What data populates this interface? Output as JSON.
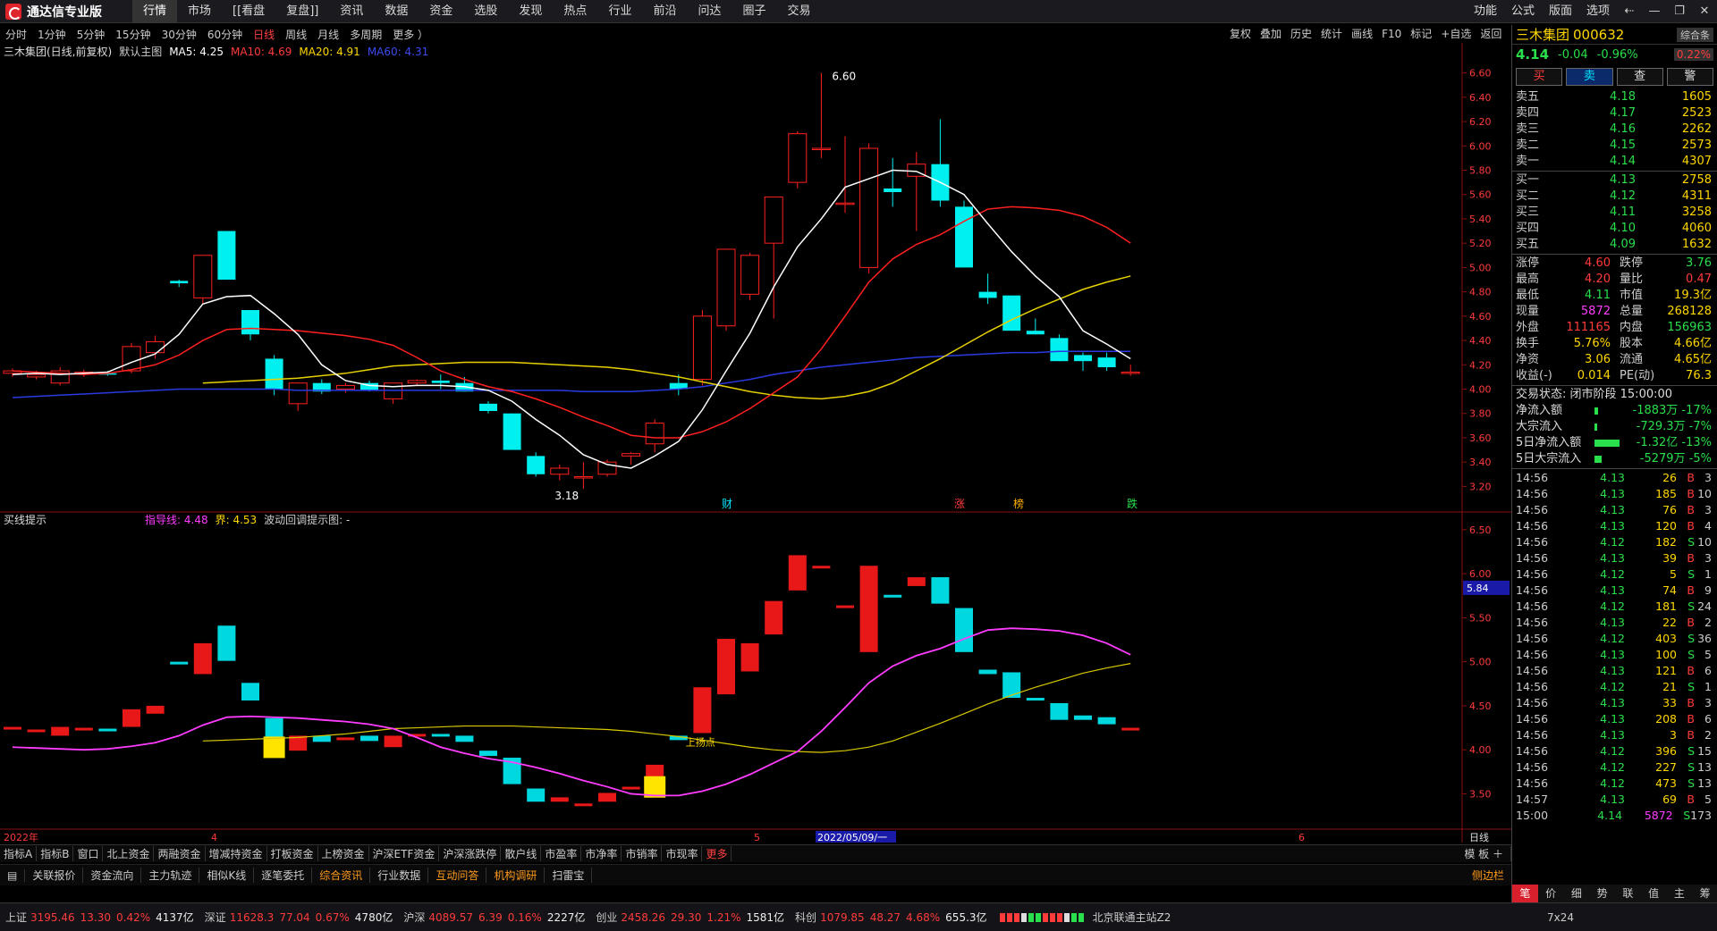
{
  "app": {
    "name": "通达信专业版",
    "menu": [
      "行情",
      "市场",
      "[[看盘",
      "复盘]]",
      "资讯",
      "数据",
      "资金",
      "选股",
      "发现",
      "热点",
      "行业",
      "前沿",
      "问达",
      "圈子",
      "交易"
    ],
    "active_menu": "行情",
    "right_menu": [
      "功能",
      "公式",
      "版面",
      "选项"
    ]
  },
  "periods": [
    "分时",
    "1分钟",
    "5分钟",
    "15分钟",
    "30分钟",
    "60分钟",
    "日线",
    "周线",
    "月线",
    "多周期",
    "更多 ）"
  ],
  "active_period": "日线",
  "right_tools": [
    "复权",
    "叠加",
    "历史",
    "统计",
    "画线",
    "F10",
    "标记",
    "+自选",
    "返回"
  ],
  "main_chart": {
    "title": "三木集团(日线,前复权)",
    "template": "默认主图",
    "ma5": "MA5: 4.25",
    "ma10": "MA10: 4.69",
    "ma20": "MA20: 4.91",
    "ma60": "MA60: 4.31",
    "high_label": "6.60",
    "low_label": "3.18",
    "y_ticks": [
      "6.60",
      "6.40",
      "6.20",
      "6.00",
      "5.80",
      "5.60",
      "5.40",
      "5.20",
      "5.00",
      "4.80",
      "4.60",
      "4.40",
      "4.20",
      "4.00",
      "3.80",
      "3.60",
      "3.40",
      "3.20"
    ],
    "markers": [
      "财",
      "涨",
      "榜",
      "跌"
    ],
    "colors": {
      "up": "#ff2020",
      "down": "#00f0f0",
      "ma5": "#ffffff",
      "ma10": "#ff2020",
      "ma20": "#e6d200",
      "ma60": "#2a3ae0"
    }
  },
  "sub_chart": {
    "title": "买线提示",
    "guide": "指导线: 4.48",
    "bound": "界: 4.53",
    "wave": "波动回调提示图: -",
    "y_ticks": [
      "6.50",
      "6.00",
      "5.50",
      "5.00",
      "4.50",
      "4.00",
      "3.50"
    ],
    "current": "5.84",
    "annotation": "上扬点"
  },
  "x_axis": {
    "labels": [
      "2022年",
      "4",
      "5",
      "2022/05/09/一",
      "6"
    ],
    "right": "日线"
  },
  "chart_data": {
    "type": "candlestick",
    "ohlc": [
      [
        4.13,
        4.17,
        4.1,
        4.15
      ],
      [
        4.1,
        4.15,
        4.08,
        4.12
      ],
      [
        4.05,
        4.18,
        4.03,
        4.15
      ],
      [
        4.13,
        4.16,
        4.1,
        4.14
      ],
      [
        4.13,
        4.15,
        4.11,
        4.12
      ],
      [
        4.15,
        4.38,
        4.13,
        4.35
      ],
      [
        4.3,
        4.44,
        4.25,
        4.39
      ],
      [
        4.89,
        4.9,
        4.84,
        4.87
      ],
      [
        4.75,
        5.1,
        4.7,
        5.1
      ],
      [
        5.3,
        5.3,
        4.9,
        4.9
      ],
      [
        4.65,
        4.65,
        4.4,
        4.45
      ],
      [
        4.25,
        4.28,
        3.95,
        4.0
      ],
      [
        3.88,
        4.05,
        3.82,
        4.05
      ],
      [
        4.05,
        4.08,
        3.96,
        3.98
      ],
      [
        4.0,
        4.05,
        3.97,
        4.03
      ],
      [
        4.05,
        4.07,
        3.98,
        3.99
      ],
      [
        3.92,
        4.05,
        3.88,
        4.05
      ],
      [
        4.05,
        4.08,
        4.03,
        4.07
      ],
      [
        4.07,
        4.12,
        4.0,
        4.05
      ],
      [
        4.05,
        4.1,
        3.98,
        3.98
      ],
      [
        3.88,
        3.9,
        3.8,
        3.82
      ],
      [
        3.8,
        3.8,
        3.5,
        3.5
      ],
      [
        3.45,
        3.48,
        3.28,
        3.3
      ],
      [
        3.3,
        3.38,
        3.25,
        3.35
      ],
      [
        3.28,
        3.4,
        3.18,
        3.28
      ],
      [
        3.3,
        3.42,
        3.28,
        3.4
      ],
      [
        3.45,
        3.48,
        3.38,
        3.47
      ],
      [
        3.55,
        3.75,
        3.48,
        3.72
      ],
      [
        4.05,
        4.12,
        3.95,
        4.0
      ],
      [
        4.08,
        4.65,
        4.03,
        4.6
      ],
      [
        4.52,
        5.15,
        4.48,
        5.15
      ],
      [
        4.78,
        5.12,
        4.73,
        5.1
      ],
      [
        5.2,
        5.58,
        4.58,
        5.58
      ],
      [
        5.7,
        6.12,
        5.65,
        6.1
      ],
      [
        5.98,
        6.6,
        5.9,
        5.98
      ],
      [
        5.53,
        6.08,
        5.45,
        5.53
      ],
      [
        5.0,
        6.02,
        4.95,
        5.98
      ],
      [
        5.65,
        5.9,
        5.5,
        5.62
      ],
      [
        5.75,
        5.95,
        5.3,
        5.85
      ],
      [
        5.85,
        6.22,
        5.5,
        5.55
      ],
      [
        5.5,
        5.55,
        5.0,
        5.0
      ],
      [
        4.8,
        4.95,
        4.7,
        4.75
      ],
      [
        4.77,
        4.75,
        4.48,
        4.48
      ],
      [
        4.48,
        4.58,
        4.45,
        4.45
      ],
      [
        4.42,
        4.45,
        4.23,
        4.23
      ],
      [
        4.28,
        4.3,
        4.15,
        4.23
      ],
      [
        4.26,
        4.3,
        4.15,
        4.18
      ],
      [
        4.14,
        4.2,
        4.11,
        4.14
      ]
    ],
    "ma5": [
      4.12,
      4.13,
      4.12,
      4.13,
      4.14,
      4.22,
      4.29,
      4.45,
      4.7,
      4.76,
      4.77,
      4.62,
      4.45,
      4.2,
      4.07,
      4.03,
      4.02,
      4.03,
      4.03,
      4.02,
      3.99,
      3.9,
      3.75,
      3.62,
      3.46,
      3.38,
      3.35,
      3.45,
      3.57,
      3.83,
      4.15,
      4.46,
      4.84,
      5.17,
      5.4,
      5.66,
      5.73,
      5.8,
      5.79,
      5.7,
      5.6,
      5.36,
      5.13,
      4.93,
      4.76,
      4.48,
      4.37,
      4.25
    ],
    "ma10": [
      4.15,
      4.14,
      4.13,
      4.12,
      4.13,
      4.16,
      4.2,
      4.28,
      4.4,
      4.49,
      4.5,
      4.49,
      4.48,
      4.46,
      4.44,
      4.41,
      4.36,
      4.26,
      4.15,
      4.08,
      4.02,
      3.98,
      3.92,
      3.85,
      3.77,
      3.7,
      3.62,
      3.6,
      3.6,
      3.65,
      3.73,
      3.84,
      3.97,
      4.1,
      4.33,
      4.6,
      4.88,
      5.07,
      5.19,
      5.27,
      5.38,
      5.48,
      5.5,
      5.49,
      5.47,
      5.42,
      5.33,
      5.2
    ],
    "ma20": [
      4.05,
      4.06,
      4.07,
      4.08,
      4.09,
      4.11,
      4.13,
      4.16,
      4.19,
      4.2,
      4.21,
      4.22,
      4.22,
      4.22,
      4.21,
      4.2,
      4.19,
      4.18,
      4.16,
      4.13,
      4.1,
      4.06,
      4.02,
      3.98,
      3.95,
      3.93,
      3.92,
      3.94,
      3.98,
      4.05,
      4.15,
      4.25,
      4.36,
      4.47,
      4.57,
      4.66,
      4.74,
      4.82,
      4.88,
      4.93
    ],
    "ma60": [
      3.93,
      3.94,
      3.95,
      3.96,
      3.97,
      3.98,
      3.99,
      4.0,
      4.0,
      4.0,
      4.0,
      4.0,
      3.99,
      3.99,
      3.99,
      3.99,
      3.99,
      3.99,
      3.99,
      3.99,
      3.99,
      3.99,
      3.99,
      3.99,
      3.98,
      3.98,
      3.98,
      3.99,
      4.0,
      4.02,
      4.05,
      4.08,
      4.12,
      4.15,
      4.18,
      4.2,
      4.22,
      4.24,
      4.26,
      4.27,
      4.28,
      4.29,
      4.3,
      4.3,
      4.31,
      4.31,
      4.31,
      4.31
    ],
    "ymin": 3.1,
    "ymax": 6.7
  },
  "stock": {
    "name": "三木集团",
    "code": "000632",
    "badge": "综合条",
    "price": "4.14",
    "change": "-0.04",
    "pct": "-0.96%",
    "weibi": "0.22%",
    "buttons": [
      "买",
      "卖",
      "查",
      "警"
    ]
  },
  "asks": [
    {
      "l": "卖五",
      "p": "4.18",
      "v": "1605"
    },
    {
      "l": "卖四",
      "p": "4.17",
      "v": "2523"
    },
    {
      "l": "卖三",
      "p": "4.16",
      "v": "2262"
    },
    {
      "l": "卖二",
      "p": "4.15",
      "v": "2573"
    },
    {
      "l": "卖一",
      "p": "4.14",
      "v": "4307"
    }
  ],
  "bids": [
    {
      "l": "买一",
      "p": "4.13",
      "v": "2758"
    },
    {
      "l": "买二",
      "p": "4.12",
      "v": "4311"
    },
    {
      "l": "买三",
      "p": "4.11",
      "v": "3258"
    },
    {
      "l": "买四",
      "p": "4.10",
      "v": "4060"
    },
    {
      "l": "买五",
      "p": "4.09",
      "v": "1632"
    }
  ],
  "stats": [
    [
      "涨停",
      "4.60",
      "跌停",
      "3.76"
    ],
    [
      "最高",
      "4.20",
      "量比",
      "0.47"
    ],
    [
      "最低",
      "4.11",
      "市值",
      "19.3亿"
    ],
    [
      "现量",
      "5872",
      "总量",
      "268128"
    ],
    [
      "外盘",
      "111165",
      "内盘",
      "156963"
    ],
    [
      "换手",
      "5.76%",
      "股本",
      "4.66亿"
    ],
    [
      "净资",
      "3.06",
      "流通",
      "4.65亿"
    ],
    [
      "收益(-)",
      "0.014",
      "PE(动)",
      "76.3"
    ]
  ],
  "trade_state": "交易状态: 闭市阶段 15:00:00",
  "flows": [
    {
      "l": "净流入额",
      "v": "-1883万 -17%"
    },
    {
      "l": "大宗流入",
      "v": "-729.3万 -7%"
    },
    {
      "l": "5日净流入额",
      "v": "-1.32亿 -13%"
    },
    {
      "l": "5日大宗流入",
      "v": "-5279万 -5%"
    }
  ],
  "ticks": [
    [
      "14:56",
      "4.13",
      "26",
      "B",
      "3"
    ],
    [
      "14:56",
      "4.13",
      "185",
      "B",
      "10"
    ],
    [
      "14:56",
      "4.13",
      "76",
      "B",
      "3"
    ],
    [
      "14:56",
      "4.13",
      "120",
      "B",
      "4"
    ],
    [
      "14:56",
      "4.12",
      "182",
      "S",
      "10"
    ],
    [
      "14:56",
      "4.13",
      "39",
      "B",
      "3"
    ],
    [
      "14:56",
      "4.12",
      "5",
      "S",
      "1"
    ],
    [
      "14:56",
      "4.13",
      "74",
      "B",
      "9"
    ],
    [
      "14:56",
      "4.12",
      "181",
      "S",
      "24"
    ],
    [
      "14:56",
      "4.13",
      "22",
      "B",
      "2"
    ],
    [
      "14:56",
      "4.12",
      "403",
      "S",
      "36"
    ],
    [
      "14:56",
      "4.13",
      "100",
      "S",
      "5"
    ],
    [
      "14:56",
      "4.13",
      "121",
      "B",
      "6"
    ],
    [
      "14:56",
      "4.12",
      "21",
      "S",
      "1"
    ],
    [
      "14:56",
      "4.13",
      "33",
      "B",
      "3"
    ],
    [
      "14:56",
      "4.13",
      "208",
      "B",
      "6"
    ],
    [
      "14:56",
      "4.13",
      "3",
      "B",
      "2"
    ],
    [
      "14:56",
      "4.12",
      "396",
      "S",
      "15"
    ],
    [
      "14:56",
      "4.12",
      "227",
      "S",
      "13"
    ],
    [
      "14:56",
      "4.12",
      "473",
      "S",
      "13"
    ],
    [
      "14:57",
      "4.13",
      "69",
      "B",
      "5"
    ],
    [
      "15:00",
      "4.14",
      "5872",
      "S",
      "173"
    ]
  ],
  "right_tabs": [
    "笔",
    "价",
    "细",
    "势",
    "联",
    "值",
    "主",
    "筹"
  ],
  "bottom_tabs": [
    "指标A",
    "指标B",
    "窗口",
    "北上资金",
    "两融资金",
    "增减持资金",
    "打板资金",
    "上榜资金",
    "沪深ETF资金",
    "沪深涨跌停",
    "散户线",
    "市盈率",
    "市净率",
    "市销率",
    "市现率",
    "更多"
  ],
  "template_btn": "模 板 ＋",
  "info_tabs": [
    "关联报价",
    "资金流向",
    "主力轨迹",
    "相似K线",
    "逐笔委托",
    "综合资讯",
    "行业数据",
    "互动问答",
    "机构调研",
    "扫雷宝"
  ],
  "sidebar_toggle": "侧边栏",
  "indices": [
    {
      "n": "上证",
      "v": "3195.46",
      "c": "13.30",
      "p": "0.42%",
      "a": "4137亿"
    },
    {
      "n": "深证",
      "v": "11628.3",
      "c": "77.04",
      "p": "0.67%",
      "a": "4780亿"
    },
    {
      "n": "沪深",
      "v": "4089.57",
      "c": "6.39",
      "p": "0.16%",
      "a": "2227亿"
    },
    {
      "n": "创业",
      "v": "2458.26",
      "c": "29.30",
      "p": "1.21%",
      "a": "1581亿"
    },
    {
      "n": "科创",
      "v": "1079.85",
      "c": "48.27",
      "p": "4.68%",
      "a": "655.3亿"
    }
  ],
  "server": "北京联通主站Z2",
  "clock": "7x24"
}
